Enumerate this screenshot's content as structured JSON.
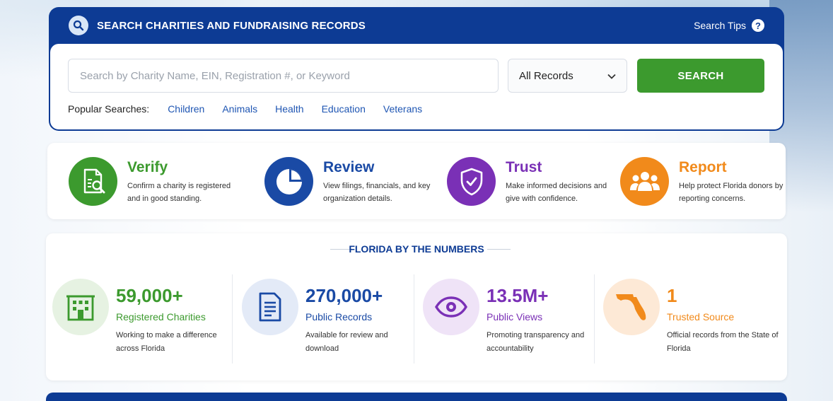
{
  "search": {
    "title": "SEARCH CHARITIES AND FUNDRAISING RECORDS",
    "tips_label": "Search Tips",
    "help_glyph": "?",
    "placeholder": "Search by Charity Name, EIN, Registration #, or Keyword",
    "input_value": "",
    "select_value": "All Records",
    "button_label": "SEARCH",
    "popular_label": "Popular Searches:",
    "popular": [
      "Children",
      "Animals",
      "Health",
      "Education",
      "Veterans"
    ]
  },
  "features": [
    {
      "title": "Verify",
      "desc": "Confirm a charity is registered and in good standing.",
      "color": "#3c9a2e",
      "icon": "document-search-icon"
    },
    {
      "title": "Review",
      "desc": "View filings, financials, and key organization details.",
      "color": "#1a4aa5",
      "icon": "pie-chart-icon"
    },
    {
      "title": "Trust",
      "desc": "Make informed decisions and give with confidence.",
      "color": "#7a30b6",
      "icon": "shield-check-icon"
    },
    {
      "title": "Report",
      "desc": "Help protect Florida donors by reporting concerns.",
      "color": "#f18a1b",
      "icon": "people-group-icon"
    }
  ],
  "numbers": {
    "title": "FLORIDA BY THE NUMBERS",
    "stats": [
      {
        "value": "59,000+",
        "label": "Registered Charities",
        "desc": "Working to make a difference across Florida",
        "color": "#3c9a2e",
        "icon": "building-icon"
      },
      {
        "value": "270,000+",
        "label": "Public Records",
        "desc": "Available for review and download",
        "color": "#1a4aa5",
        "icon": "document-icon"
      },
      {
        "value": "13.5M+",
        "label": "Public Views",
        "desc": "Promoting transparency and accountability",
        "color": "#7a30b6",
        "icon": "eye-icon"
      },
      {
        "value": "1",
        "label": "Trusted Source",
        "desc": "Official records from the State of Florida",
        "color": "#f18a1b",
        "icon": "florida-map-icon"
      }
    ]
  }
}
